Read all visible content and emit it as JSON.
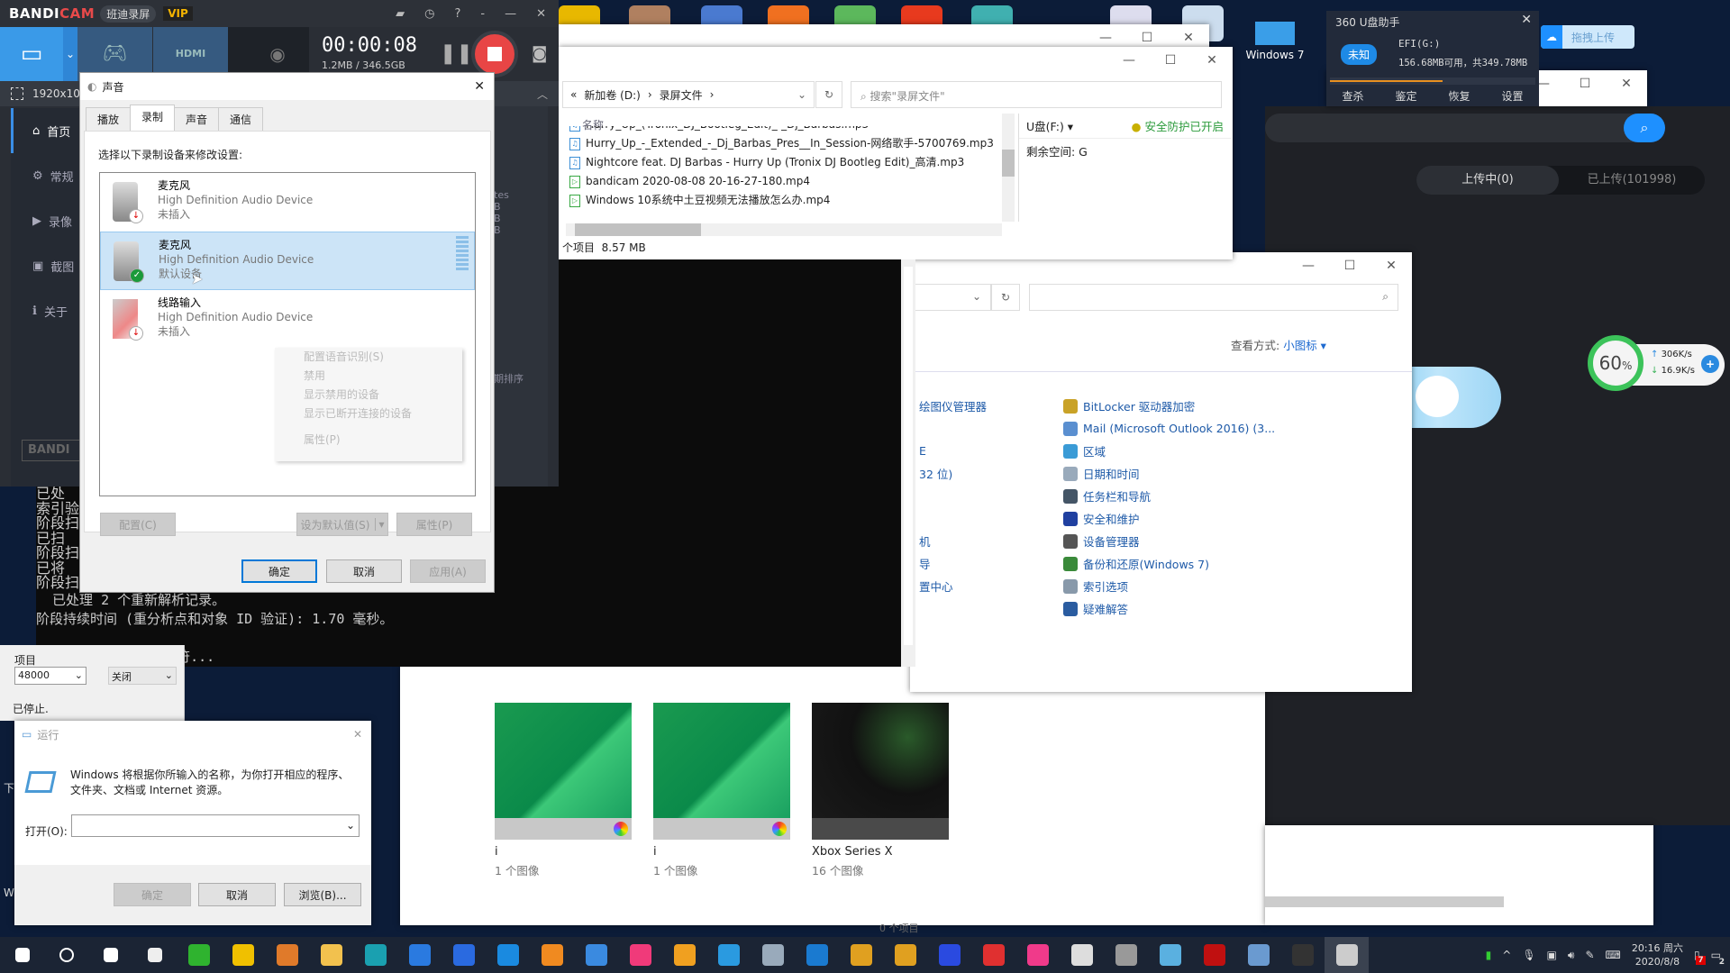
{
  "desktop": {
    "top_icons": [
      {
        "name": "app-yellow",
        "color": "#e8b800"
      },
      {
        "name": "app-photo",
        "color": "#b08060"
      },
      {
        "name": "app-pen",
        "color": "#4a7ad0"
      },
      {
        "name": "app-orange",
        "color": "#f07020"
      },
      {
        "name": "app-green",
        "color": "#5cb85c"
      },
      {
        "name": "app-red-05",
        "color": "#e83a1e"
      },
      {
        "name": "app-zombie",
        "color": "#40b0b0"
      },
      {
        "name": "app-dialog-thumb",
        "color": "#dde"
      },
      {
        "name": "app-window-thumb",
        "color": "#cde"
      }
    ],
    "windows7_label": "Windows 7"
  },
  "bandicam": {
    "brand_a": "BANDI",
    "brand_b": "CAM",
    "subtitle": "班迪录屏",
    "vip": "VIP",
    "timer": "00:00:08",
    "size": "1.2MB / 346.5GB",
    "resolution": "1920x10",
    "sidebar": [
      {
        "label": "首页",
        "icon": "⌂"
      },
      {
        "label": "常规",
        "icon": "⚙"
      },
      {
        "label": "录像",
        "icon": "▶"
      },
      {
        "label": "截图",
        "icon": "▣"
      },
      {
        "label": "关于",
        "icon": "ℹ"
      }
    ],
    "logo_bottom": "BANDI",
    "side_fragments": [
      "tes",
      "B",
      "B",
      "B",
      "期排序"
    ],
    "settings": {
      "label": "项目",
      "rate": "48000",
      "mode": "关闭",
      "status": "已停止."
    },
    "stray_left": [
      "下",
      "W"
    ]
  },
  "sound_dialog": {
    "title": "声音",
    "tabs": [
      "播放",
      "录制",
      "声音",
      "通信"
    ],
    "selected_tab": 1,
    "instruction": "选择以下录制设备来修改设置:",
    "devices": [
      {
        "name": "麦克风",
        "driver": "High Definition Audio Device",
        "status": "未插入",
        "badge": "unplugged"
      },
      {
        "name": "麦克风",
        "driver": "High Definition Audio Device",
        "status": "默认设备",
        "badge": "default"
      },
      {
        "name": "线路输入",
        "driver": "High Definition Audio Device",
        "status": "未插入",
        "badge": "unplugged"
      }
    ],
    "context_menu": [
      "配置语音识别(S)",
      "禁用",
      "显示禁用的设备",
      "显示已断开连接的设备",
      "属性(P)"
    ],
    "configure": "配置(C)",
    "set_default": "设为默认值(S)",
    "properties": "属性(P)",
    "ok": "确定",
    "cancel": "取消",
    "apply": "应用(A)"
  },
  "explorer": {
    "breadcrumb": [
      "新加卷 (D:)",
      "录屏文件"
    ],
    "search_placeholder": "搜索\"录屏文件\"",
    "column_name": "名称",
    "files": [
      {
        "name": "Hurry_Up_(Tronix_DJ_Bootleg_Edit)_-_Dj_Barbas.mp3",
        "type": "audio"
      },
      {
        "name": "Hurry_Up_-_Extended_-_Dj_Barbas_Pres__In_Session-网络歌手-5700769.mp3",
        "type": "audio"
      },
      {
        "name": "Nightcore feat. DJ Barbas - Hurry Up (Tronix DJ Bootleg Edit)_高清.mp3",
        "type": "audio"
      },
      {
        "name": "bandicam 2020-08-08 20-16-27-180.mp4",
        "type": "video"
      },
      {
        "name": "Windows 10系统中土豆视频无法播放怎么办.mp4",
        "type": "video"
      }
    ],
    "status": "个项目  8.57 MB",
    "usb_label": "U盘(F:) ▾",
    "protection": "安全防护已开启",
    "free_space": "剩余空间: G"
  },
  "console": {
    "lines_left": [
      "已处",
      "索引验",
      "阶段扫",
      "已扫",
      "阶段扫",
      "已将",
      "阶段扫"
    ],
    "lines": [
      "  已处理 2 个重新解析记录。",
      "阶段持续时间 (重分析点和对象 ID 验证): 1.70 毫秒。",
      "",
      "阶段 3: 检查安全描述符..."
    ]
  },
  "control_panel": {
    "view_label": "查看方式:",
    "view_value": "小图标 ▾",
    "left_fragments": [
      "绘图仪管理器",
      "",
      "E",
      "32 位)",
      "",
      "",
      "机",
      "导",
      "置中心"
    ],
    "items": [
      {
        "label": "BitLocker 驱动器加密",
        "color": "#c9a227"
      },
      {
        "label": "Mail (Microsoft Outlook 2016) (3...",
        "color": "#5a8fd0"
      },
      {
        "label": "区域",
        "color": "#3a9bd6"
      },
      {
        "label": "日期和时间",
        "color": "#9ab"
      },
      {
        "label": "任务栏和导航",
        "color": "#456"
      },
      {
        "label": "安全和维护",
        "color": "#2040a0"
      },
      {
        "label": "设备管理器",
        "color": "#555"
      },
      {
        "label": "备份和还原(Windows 7)",
        "color": "#3a8a3a"
      },
      {
        "label": "索引选项",
        "color": "#8899aa"
      },
      {
        "label": "疑难解答",
        "color": "#2a5ca0"
      }
    ]
  },
  "photos": {
    "albums": [
      {
        "title": "i",
        "count": "1 个图像",
        "kind": "green"
      },
      {
        "title": "i",
        "count": "1 个图像",
        "kind": "green"
      },
      {
        "title": "Xbox Series X",
        "count": "16 个图像",
        "kind": "xbox"
      }
    ],
    "footer": "0 个项目"
  },
  "usb_helper": {
    "title": "360 U盘助手",
    "badge": "未知",
    "drive": "EFI(G:)",
    "space": "156.68MB可用，共349.78MB",
    "used_fraction": 0.55,
    "actions": [
      "查杀",
      "鉴定",
      "恢复",
      "设置"
    ]
  },
  "netdisk": {
    "upload_drag": "拖拽上传",
    "tab_uploading": "上传中(0)",
    "tab_uploaded": "已上传(101998)"
  },
  "speed_widget": {
    "percent": "60",
    "unit": "%",
    "up": "306K/s",
    "down": "16.9K/s"
  },
  "run_dialog": {
    "title": "运行",
    "description": "Windows 将根据你所输入的名称，为你打开相应的程序、文件夹、文档或 Internet 资源。",
    "open_label": "打开(O):",
    "value": "",
    "ok": "确定",
    "cancel": "取消",
    "browse": "浏览(B)..."
  },
  "taskbar": {
    "icons": [
      {
        "name": "start",
        "color": "#fff"
      },
      {
        "name": "search",
        "color": "#fff"
      },
      {
        "name": "task-view",
        "color": "#fff"
      },
      {
        "name": "app-s",
        "color": "#eee"
      },
      {
        "name": "app-green-circle",
        "color": "#2fb32f"
      },
      {
        "name": "qq",
        "color": "#f0c000"
      },
      {
        "name": "player",
        "color": "#e07a2a"
      },
      {
        "name": "file-explorer",
        "color": "#f2c14e"
      },
      {
        "name": "app-tools",
        "color": "#1aa0b0"
      },
      {
        "name": "app-q",
        "color": "#2a7ae0"
      },
      {
        "name": "app-u",
        "color": "#2a6ae0"
      },
      {
        "name": "app-m",
        "color": "#1a8ae0"
      },
      {
        "name": "app-orange-ball",
        "color": "#f08a20"
      },
      {
        "name": "app-cloud",
        "color": "#3a8ae0"
      },
      {
        "name": "app-pink",
        "color": "#f03a7a"
      },
      {
        "name": "app-yk",
        "color": "#f0a020"
      },
      {
        "name": "app-q2",
        "color": "#2a9ae0"
      },
      {
        "name": "app-box",
        "color": "#9ab"
      },
      {
        "name": "edge",
        "color": "#1a7ad0"
      },
      {
        "name": "app-frame",
        "color": "#e0a020"
      },
      {
        "name": "chrome",
        "color": "#e0a020"
      },
      {
        "name": "app-flame",
        "color": "#2a4ae0"
      },
      {
        "name": "bandicam-rec",
        "color": "#e03030"
      },
      {
        "name": "app-pink2",
        "color": "#f03a8a"
      },
      {
        "name": "settings",
        "color": "#ddd"
      },
      {
        "name": "app-gray",
        "color": "#999"
      },
      {
        "name": "app-blue-window",
        "color": "#5ab0e0"
      },
      {
        "name": "flash",
        "color": "#c01010"
      },
      {
        "name": "app-doc",
        "color": "#6a9ad0"
      },
      {
        "name": "cmd",
        "color": "#333"
      },
      {
        "name": "app-active",
        "color": "#ccc"
      }
    ],
    "time": "20:16 周六",
    "date": "2020/8/8",
    "notification_count": "7",
    "action_center_count": "2"
  }
}
